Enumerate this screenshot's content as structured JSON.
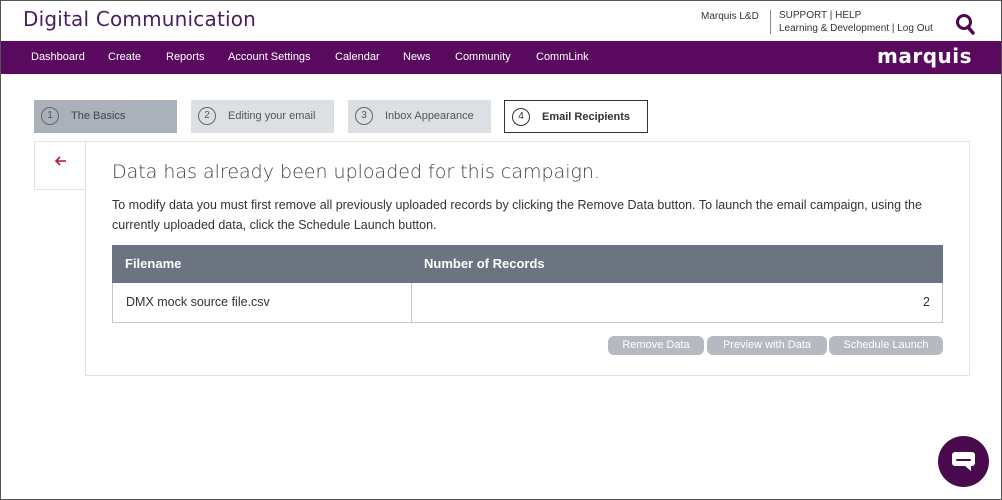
{
  "header": {
    "app_title": "Digital Communication",
    "user_name": "Marquis L&D",
    "links": {
      "support": "SUPPORT",
      "divider": "|",
      "help": "HELP",
      "learning": "Learning & Development",
      "logout": "Log Out"
    }
  },
  "nav": {
    "items": [
      "Dashboard",
      "Create",
      "Reports",
      "Account Settings",
      "Calendar",
      "News",
      "Community",
      "CommLink"
    ],
    "brand": "marquis"
  },
  "steps": [
    {
      "num": "1",
      "label": "The Basics",
      "state": "done"
    },
    {
      "num": "2",
      "label": "Editing your email",
      "state": "pending"
    },
    {
      "num": "3",
      "label": "Inbox Appearance",
      "state": "pending"
    },
    {
      "num": "4",
      "label": "Email Recipients",
      "state": "active"
    }
  ],
  "panel": {
    "title": "Data has already been uploaded for this campaign.",
    "description": "To modify data you must first remove all previously uploaded records by clicking the Remove Data button. To launch the email campaign, using the currently uploaded data, click the Schedule Launch button."
  },
  "table": {
    "columns": [
      "Filename",
      "Number of Records"
    ],
    "rows": [
      {
        "filename": "DMX mock source file.csv",
        "records": "2"
      }
    ]
  },
  "actions": {
    "remove": "Remove Data",
    "preview": "Preview with Data",
    "schedule": "Schedule Launch"
  },
  "colors": {
    "brand_purple": "#5a0a5e",
    "title_purple": "#4a1e5e",
    "table_header": "#6b7480",
    "button_gray": "#b5bac2",
    "back_arrow": "#b0203a"
  },
  "icons": {
    "search": "search-icon",
    "back": "arrow-left-icon",
    "chat": "chat-bubble-icon"
  }
}
